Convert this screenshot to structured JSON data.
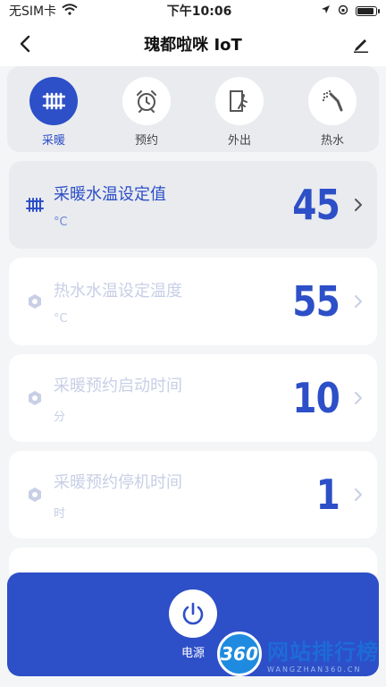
{
  "status_bar": {
    "carrier": "无SIM卡",
    "time": "下午10:06",
    "battery_level": 0.9
  },
  "nav": {
    "title": "瑰都啦咪 IoT"
  },
  "modes": [
    {
      "label": "采暖",
      "icon": "radiator-icon",
      "active": true
    },
    {
      "label": "预约",
      "icon": "alarm-clock-icon",
      "active": false
    },
    {
      "label": "外出",
      "icon": "exit-door-icon",
      "active": false
    },
    {
      "label": "热水",
      "icon": "shower-icon",
      "active": false
    }
  ],
  "settings": [
    {
      "title": "采暖水温设定值",
      "unit": "°C",
      "value": "45",
      "icon": "radiator-icon",
      "state": "active"
    },
    {
      "title": "热水水温设定温度",
      "unit": "°C",
      "value": "55",
      "icon": "hexagon-icon",
      "state": "disabled"
    },
    {
      "title": "采暖预约启动时间",
      "unit": "分",
      "value": "10",
      "icon": "hexagon-icon",
      "state": "disabled"
    },
    {
      "title": "采暖预约停机时间",
      "unit": "时",
      "value": "1",
      "icon": "hexagon-icon",
      "state": "disabled"
    }
  ],
  "power": {
    "label": "电源"
  },
  "watermark": {
    "badge": "360",
    "cn": "网站排行榜",
    "en": "WANGZHAN360.CN"
  },
  "colors": {
    "accent": "#2d4fc7",
    "disabled_text": "#c8cfe6"
  }
}
